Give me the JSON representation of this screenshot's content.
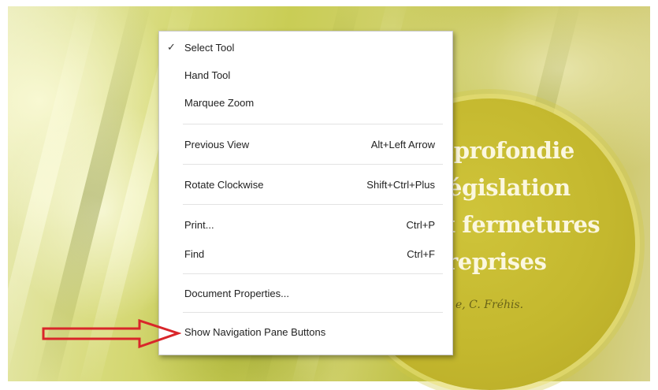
{
  "cover": {
    "lines": [
      "pprofondie",
      "égislation",
      "x fermetures",
      "reprises"
    ],
    "author": "e, C. Fréhis."
  },
  "menu": {
    "items": [
      {
        "label": "Select Tool",
        "checked": true,
        "shortcut": ""
      },
      {
        "label": "Hand Tool",
        "checked": false,
        "shortcut": ""
      },
      {
        "label": "Marquee Zoom",
        "checked": false,
        "shortcut": ""
      },
      {
        "label": "Previous View",
        "checked": false,
        "shortcut": "Alt+Left Arrow"
      },
      {
        "label": "Rotate Clockwise",
        "checked": false,
        "shortcut": "Shift+Ctrl+Plus"
      },
      {
        "label": "Print...",
        "checked": false,
        "shortcut": "Ctrl+P"
      },
      {
        "label": "Find",
        "checked": false,
        "shortcut": "Ctrl+F"
      },
      {
        "label": "Document Properties...",
        "checked": false,
        "shortcut": ""
      },
      {
        "label": "Show Navigation Pane Buttons",
        "checked": false,
        "shortcut": ""
      }
    ],
    "check_mark": "✓"
  },
  "colors": {
    "arrow": "#d9262a",
    "cover_text": "#fbf7df",
    "circle": "#c4b82e"
  },
  "icons": {
    "check": "check-icon",
    "annotation_arrow": "arrow-right-icon"
  }
}
